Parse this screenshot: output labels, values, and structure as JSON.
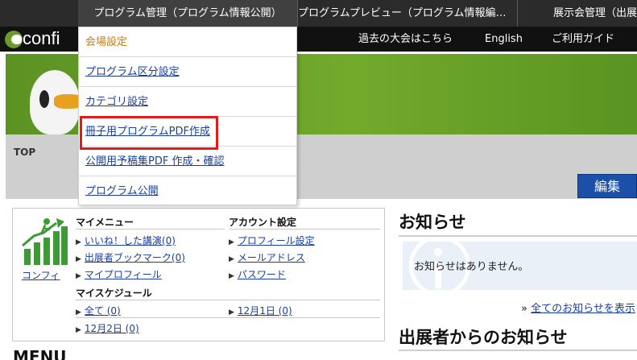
{
  "topnav": {
    "tabs": [
      {
        "label": "プログラム管理（プログラム情報公開）",
        "active": true
      },
      {
        "label": "プログラムプレビュー（プログラム情報編…",
        "active": false
      },
      {
        "label": "展示会管理（出展",
        "active": false
      }
    ]
  },
  "subnav": {
    "logo_text": "confi",
    "links": [
      "過去の大会はこちら",
      "English",
      "ご利用ガイド"
    ]
  },
  "breadcrumb": "TOP",
  "edit_button": "編集",
  "dropdown": {
    "items": [
      {
        "label": "会場設定",
        "current": true
      },
      {
        "label": "プログラム区分設定",
        "current": false
      },
      {
        "label": "カテゴリ設定",
        "current": false
      },
      {
        "label": "冊子用プログラムPDF作成",
        "current": false
      },
      {
        "label": "公開用予稿集PDF 作成・確認",
        "current": false
      },
      {
        "label": "プログラム公開",
        "current": false
      }
    ]
  },
  "panel": {
    "avatar_label": "コンフィ",
    "my_menu": {
      "heading": "マイメニュー",
      "items": [
        "いいね！した講演(0)",
        "出展者ブックマーク(0)",
        "マイプロフィール"
      ]
    },
    "account": {
      "heading": "アカウント設定",
      "items": [
        "プロフィール設定",
        "メールアドレス",
        "パスワード"
      ]
    },
    "schedule": {
      "heading": "マイスケジュール",
      "items": [
        "全て (0)",
        "12月1日 (0)",
        "12月2日 (0)"
      ]
    }
  },
  "menu_heading": "MENU",
  "news": {
    "title": "お知らせ",
    "empty_message": "お知らせはありません。",
    "all_link_prefix": "»",
    "all_link": "全てのお知らせを表示"
  },
  "exhibitor_news": {
    "title": "出展者からのお知らせ"
  },
  "colors": {
    "topnav_bg": "#2b2b2b",
    "banner_green": "#6aa32a",
    "link_blue": "#1a3f9a",
    "edit_button_bg": "#1c4fa8",
    "highlight_red": "#e11a1a",
    "current_item_orange": "#d07a00"
  }
}
